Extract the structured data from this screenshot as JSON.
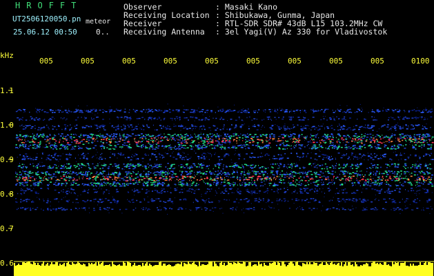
{
  "header": {
    "brand": "HROFFT",
    "file_name": "UT2506120050.pn",
    "file_kind": "meteor",
    "date_time": "25.06.12 00:50",
    "date_extra": "0..",
    "metadata": [
      {
        "key": "Observer",
        "value": ": Masaki Kano"
      },
      {
        "key": "Receiving Location",
        "value": ": Shibukawa, Gunma, Japan"
      },
      {
        "key": "Receiver",
        "value": ": RTL-SDR SDR# 43dB L15 103.2MHz CW"
      },
      {
        "key": "Receiving Antenna",
        "value": ": 3el Yagi(V) Az 330 for Vladivostok"
      }
    ]
  },
  "axis": {
    "unit": "kHz",
    "y_ticks": [
      "1.1",
      "1.0",
      "0.9",
      "0.8",
      "0.7",
      "0.6"
    ],
    "x_ticks": [
      "005",
      "005",
      "005",
      "005",
      "005",
      "005",
      "005",
      "005",
      "005",
      "0100"
    ]
  },
  "colors": {
    "background": "#000000",
    "brand": "#41e07a",
    "meta": "#9ff2ff",
    "axis": "#ffff3a",
    "strong_signal": "#ff3355",
    "mid_signal": "#22dd88",
    "weak_signal": "#1f3fc8"
  }
}
